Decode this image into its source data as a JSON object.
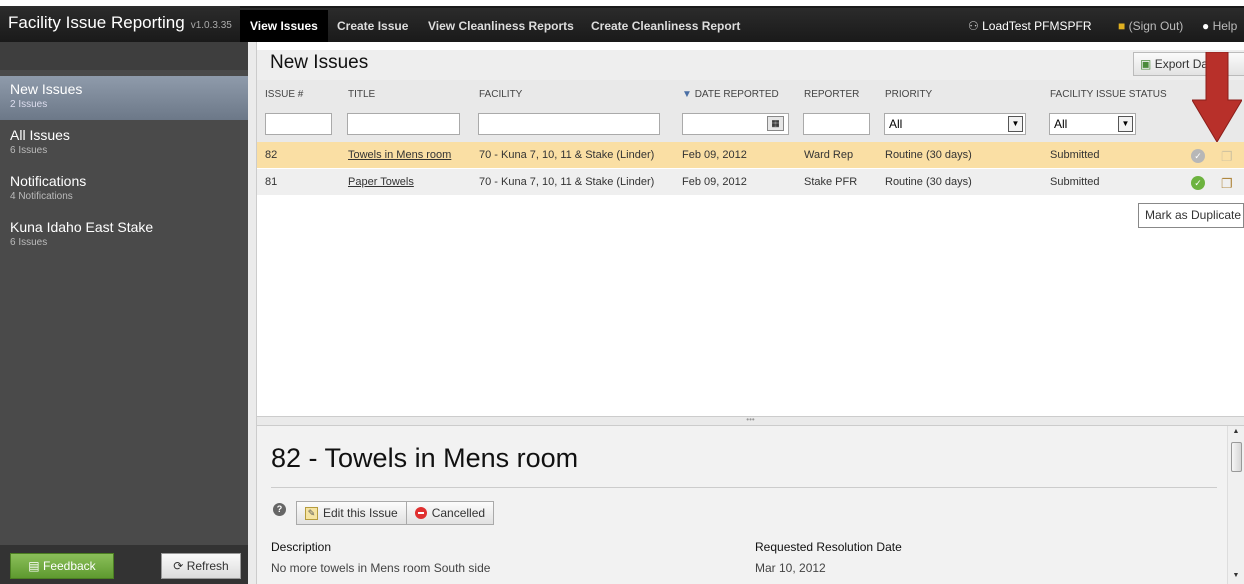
{
  "app": {
    "title": "Facility Issue Reporting",
    "version": "v1.0.3.35"
  },
  "nav": {
    "tabs": [
      {
        "label": "View Issues",
        "active": true
      },
      {
        "label": "Create Issue"
      },
      {
        "label": "View Cleanliness Reports"
      },
      {
        "label": "Create Cleanliness Report"
      }
    ]
  },
  "user": {
    "name": "LoadTest PFMSPFR",
    "signout": "(Sign Out)",
    "help": "Help"
  },
  "sidebar": {
    "items": [
      {
        "title": "New Issues",
        "sub": "2 Issues"
      },
      {
        "title": "All Issues",
        "sub": "6 Issues"
      },
      {
        "title": "Notifications",
        "sub": "4 Notifications"
      },
      {
        "title": "Kuna Idaho East Stake",
        "sub": "6 Issues"
      }
    ],
    "feedback": "Feedback",
    "refresh": "Refresh"
  },
  "main": {
    "title": "New Issues",
    "export": "Export Data",
    "columns": {
      "issue": "ISSUE #",
      "title": "TITLE",
      "facility": "FACILITY",
      "date": "DATE REPORTED",
      "reporter": "REPORTER",
      "priority": "PRIORITY",
      "status": "FACILITY ISSUE STATUS"
    },
    "filters": {
      "priority": "All",
      "status": "All"
    },
    "rows": [
      {
        "issue": "82",
        "title": "Towels in Mens room",
        "facility": "70 - Kuna 7, 10, 11 & Stake (Linder)",
        "date": "Feb 09, 2012",
        "reporter": "Ward Rep",
        "priority": "Routine (30 days)",
        "status": "Submitted"
      },
      {
        "issue": "81",
        "title": "Paper Towels",
        "facility": "70 - Kuna 7, 10, 11 & Stake (Linder)",
        "date": "Feb 09, 2012",
        "reporter": "Stake PFR",
        "priority": "Routine (30 days)",
        "status": "Submitted"
      }
    ],
    "tooltip": "Mark as Duplicate"
  },
  "detail": {
    "title": "82 - Towels in Mens room",
    "edit": "Edit this Issue",
    "cancelled": "Cancelled",
    "description_label": "Description",
    "description": "No more towels in Mens room South side",
    "resolution_label": "Requested Resolution Date",
    "resolution": "Mar 10, 2012"
  },
  "colors": {
    "selected_row": "#fadfa4",
    "arrow": "#b8302a",
    "approve_green": "#6db33f"
  }
}
